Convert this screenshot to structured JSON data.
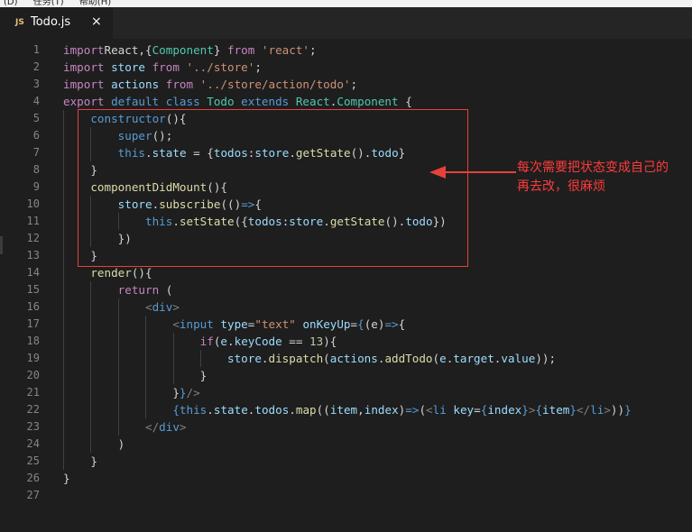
{
  "menu": [
    "(D)",
    "任务(T)",
    "帮助(H)"
  ],
  "tab": {
    "icon": "JS",
    "label": "Todo.js",
    "close": "×"
  },
  "annotation": {
    "line1": "每次需要把状态变成自己的",
    "line2": "再去改，很麻烦"
  },
  "colors": {
    "keyword": "#569cd6",
    "import": "#c586c0",
    "string": "#ce9178",
    "class": "#4ec9b0",
    "function": "#dcdcaa",
    "variable": "#9cdcfe",
    "number": "#b5cea8",
    "annotation": "#ff3b3b"
  },
  "lines": [
    [
      [
        "imp",
        "import"
      ],
      [
        "",
        "React,{"
      ],
      [
        "cls",
        "Component"
      ],
      [
        "",
        "} "
      ],
      [
        "imp",
        "from"
      ],
      [
        "",
        ""
      ],
      [
        "str",
        " 'react'"
      ],
      [
        "",
        ";"
      ]
    ],
    [
      [
        "imp",
        "import"
      ],
      [
        "",
        ""
      ],
      [
        "var",
        " store"
      ],
      [
        "",
        ""
      ],
      [
        "imp",
        " from"
      ],
      [
        "str",
        " '../store'"
      ],
      [
        "",
        ";"
      ]
    ],
    [
      [
        "imp",
        "import"
      ],
      [
        "var",
        " actions"
      ],
      [
        "imp",
        " from"
      ],
      [
        "str",
        " '../store/action/todo'"
      ],
      [
        "",
        ";"
      ]
    ],
    [
      [
        "imp",
        "export"
      ],
      [
        "kw",
        " default"
      ],
      [
        "kw",
        " class"
      ],
      [
        "cls",
        " Todo"
      ],
      [
        "kw",
        " extends"
      ],
      [
        "cls",
        " React"
      ],
      [
        "",
        "."
      ],
      [
        "cls",
        "Component"
      ],
      [
        "",
        " {"
      ]
    ],
    [
      [
        "",
        "    "
      ],
      [
        "kw",
        "constructor"
      ],
      [
        "",
        "(){"
      ]
    ],
    [
      [
        "",
        "        "
      ],
      [
        "kw",
        "super"
      ],
      [
        "",
        "();"
      ]
    ],
    [
      [
        "",
        "        "
      ],
      [
        "kw",
        "this"
      ],
      [
        "",
        "."
      ],
      [
        "var",
        "state"
      ],
      [
        "",
        " = {"
      ],
      [
        "var",
        "todos"
      ],
      [
        "",
        ":"
      ],
      [
        "var",
        "store"
      ],
      [
        "",
        "."
      ],
      [
        "fn",
        "getState"
      ],
      [
        "",
        "()."
      ],
      [
        "var",
        "todo"
      ],
      [
        "",
        "}"
      ]
    ],
    [
      [
        "",
        "    }"
      ]
    ],
    [
      [
        "",
        "    "
      ],
      [
        "fn",
        "componentDidMount"
      ],
      [
        "",
        "(){"
      ]
    ],
    [
      [
        "",
        "        "
      ],
      [
        "var",
        "store"
      ],
      [
        "",
        "."
      ],
      [
        "fn",
        "subscribe"
      ],
      [
        "",
        "(()"
      ],
      [
        "kw",
        "=>"
      ],
      [
        "",
        "{"
      ]
    ],
    [
      [
        "",
        "            "
      ],
      [
        "kw",
        "this"
      ],
      [
        "",
        "."
      ],
      [
        "fn",
        "setState"
      ],
      [
        "",
        "({"
      ],
      [
        "var",
        "todos"
      ],
      [
        "",
        ":"
      ],
      [
        "var",
        "store"
      ],
      [
        "",
        "."
      ],
      [
        "fn",
        "getState"
      ],
      [
        "",
        "()."
      ],
      [
        "var",
        "todo"
      ],
      [
        "",
        "})"
      ]
    ],
    [
      [
        "",
        "        })"
      ]
    ],
    [
      [
        "",
        "    }"
      ]
    ],
    [
      [
        "",
        "    "
      ],
      [
        "fn",
        "render"
      ],
      [
        "",
        "(){"
      ]
    ],
    [
      [
        "",
        "        "
      ],
      [
        "imp",
        "return"
      ],
      [
        "",
        " ("
      ]
    ],
    [
      [
        "",
        "            "
      ],
      [
        "brk",
        "<"
      ],
      [
        "tag",
        "div"
      ],
      [
        "brk",
        ">"
      ]
    ],
    [
      [
        "",
        "                "
      ],
      [
        "brk",
        "<"
      ],
      [
        "tag",
        "input"
      ],
      [
        "attr",
        " type"
      ],
      [
        "",
        "="
      ],
      [
        "str",
        "\"text\""
      ],
      [
        "attr",
        " onKeyUp"
      ],
      [
        "",
        "="
      ],
      [
        "kw",
        "{"
      ],
      [
        "",
        "(e)"
      ],
      [
        "kw",
        "=>"
      ],
      [
        "",
        "{"
      ]
    ],
    [
      [
        "",
        "                    "
      ],
      [
        "imp",
        "if"
      ],
      [
        "",
        "("
      ],
      [
        "var",
        "e"
      ],
      [
        "",
        "."
      ],
      [
        "var",
        "keyCode"
      ],
      [
        "",
        " == "
      ],
      [
        "num",
        "13"
      ],
      [
        "",
        "){"
      ]
    ],
    [
      [
        "",
        "                        "
      ],
      [
        "var",
        "store"
      ],
      [
        "",
        "."
      ],
      [
        "fn",
        "dispatch"
      ],
      [
        "",
        "("
      ],
      [
        "var",
        "actions"
      ],
      [
        "",
        "."
      ],
      [
        "fn",
        "addTodo"
      ],
      [
        "",
        "("
      ],
      [
        "var",
        "e"
      ],
      [
        "",
        "."
      ],
      [
        "var",
        "target"
      ],
      [
        "",
        "."
      ],
      [
        "var",
        "value"
      ],
      [
        "",
        "));"
      ]
    ],
    [
      [
        "",
        "                    }"
      ]
    ],
    [
      [
        "",
        "                }"
      ],
      [
        "kw",
        "}"
      ],
      [
        "brk",
        "/>"
      ]
    ],
    [
      [
        "",
        "                "
      ],
      [
        "kw",
        "{"
      ],
      [
        "kw",
        "this"
      ],
      [
        "",
        "."
      ],
      [
        "var",
        "state"
      ],
      [
        "",
        "."
      ],
      [
        "var",
        "todos"
      ],
      [
        "",
        "."
      ],
      [
        "fn",
        "map"
      ],
      [
        "",
        "(("
      ],
      [
        "var",
        "item"
      ],
      [
        "",
        ","
      ],
      [
        "var",
        "index"
      ],
      [
        "",
        ")"
      ],
      [
        "kw",
        "=>"
      ],
      [
        "",
        "("
      ],
      [
        "brk",
        "<"
      ],
      [
        "tag",
        "li"
      ],
      [
        "attr",
        " key"
      ],
      [
        "",
        "="
      ],
      [
        "kw",
        "{"
      ],
      [
        "var",
        "index"
      ],
      [
        "kw",
        "}"
      ],
      [
        "brk",
        ">"
      ],
      [
        "kw",
        "{"
      ],
      [
        "var",
        "item"
      ],
      [
        "kw",
        "}"
      ],
      [
        "brk",
        "</"
      ],
      [
        "tag",
        "li"
      ],
      [
        "brk",
        ">"
      ],
      [
        "",
        "))"
      ],
      [
        "kw",
        "}"
      ]
    ],
    [
      [
        "",
        "            "
      ],
      [
        "brk",
        "</"
      ],
      [
        "tag",
        "div"
      ],
      [
        "brk",
        ">"
      ]
    ],
    [
      [
        "",
        "        )"
      ]
    ],
    [
      [
        "",
        "    }"
      ]
    ],
    [
      [
        "",
        "}"
      ]
    ],
    [
      [
        "",
        ""
      ]
    ]
  ],
  "line_numbers": [
    "1",
    "2",
    "3",
    "4",
    "5",
    "6",
    "7",
    "8",
    "9",
    "10",
    "11",
    "12",
    "13",
    "14",
    "15",
    "16",
    "17",
    "18",
    "19",
    "20",
    "21",
    "22",
    "23",
    "24",
    "25",
    "26",
    "27"
  ]
}
